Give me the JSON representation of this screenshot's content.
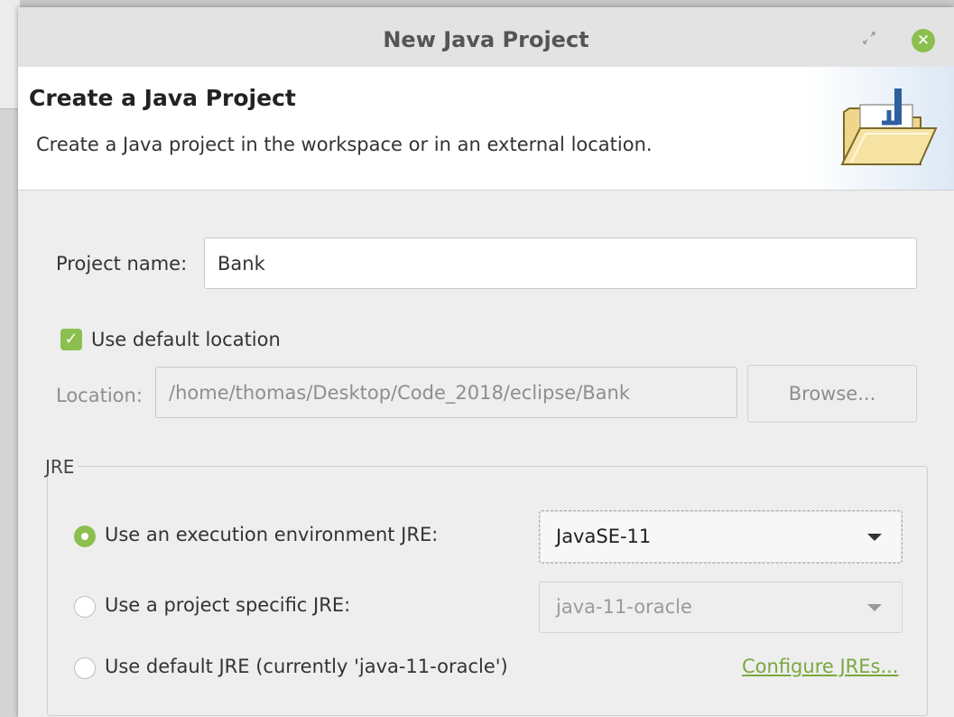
{
  "window": {
    "title": "New Java Project",
    "restore_icon": "restore-icon",
    "close_icon": "close-icon",
    "close_glyph": "✕",
    "accent": "#8bbf4f"
  },
  "banner": {
    "title": "Create a Java Project",
    "description": "Create a Java project in the workspace or in an external location.",
    "icon": "folder-icon"
  },
  "form": {
    "project_name_label": "Project name:",
    "project_name_value": "Bank",
    "use_default_location_label": "Use default location",
    "use_default_location_checked": true,
    "location_label": "Location:",
    "location_value": "/home/thomas/Desktop/Code_2018/eclipse/Bank",
    "browse_label": "Browse..."
  },
  "jre": {
    "group_label": "JRE",
    "options": [
      {
        "label": "Use an execution environment JRE:",
        "selected": true
      },
      {
        "label": "Use a project specific JRE:",
        "selected": false
      },
      {
        "label": "Use default JRE (currently 'java-11-oracle')",
        "selected": false
      }
    ],
    "execution_env_value": "JavaSE-11",
    "project_specific_value": "java-11-oracle",
    "configure_link": "Configure JREs..."
  }
}
